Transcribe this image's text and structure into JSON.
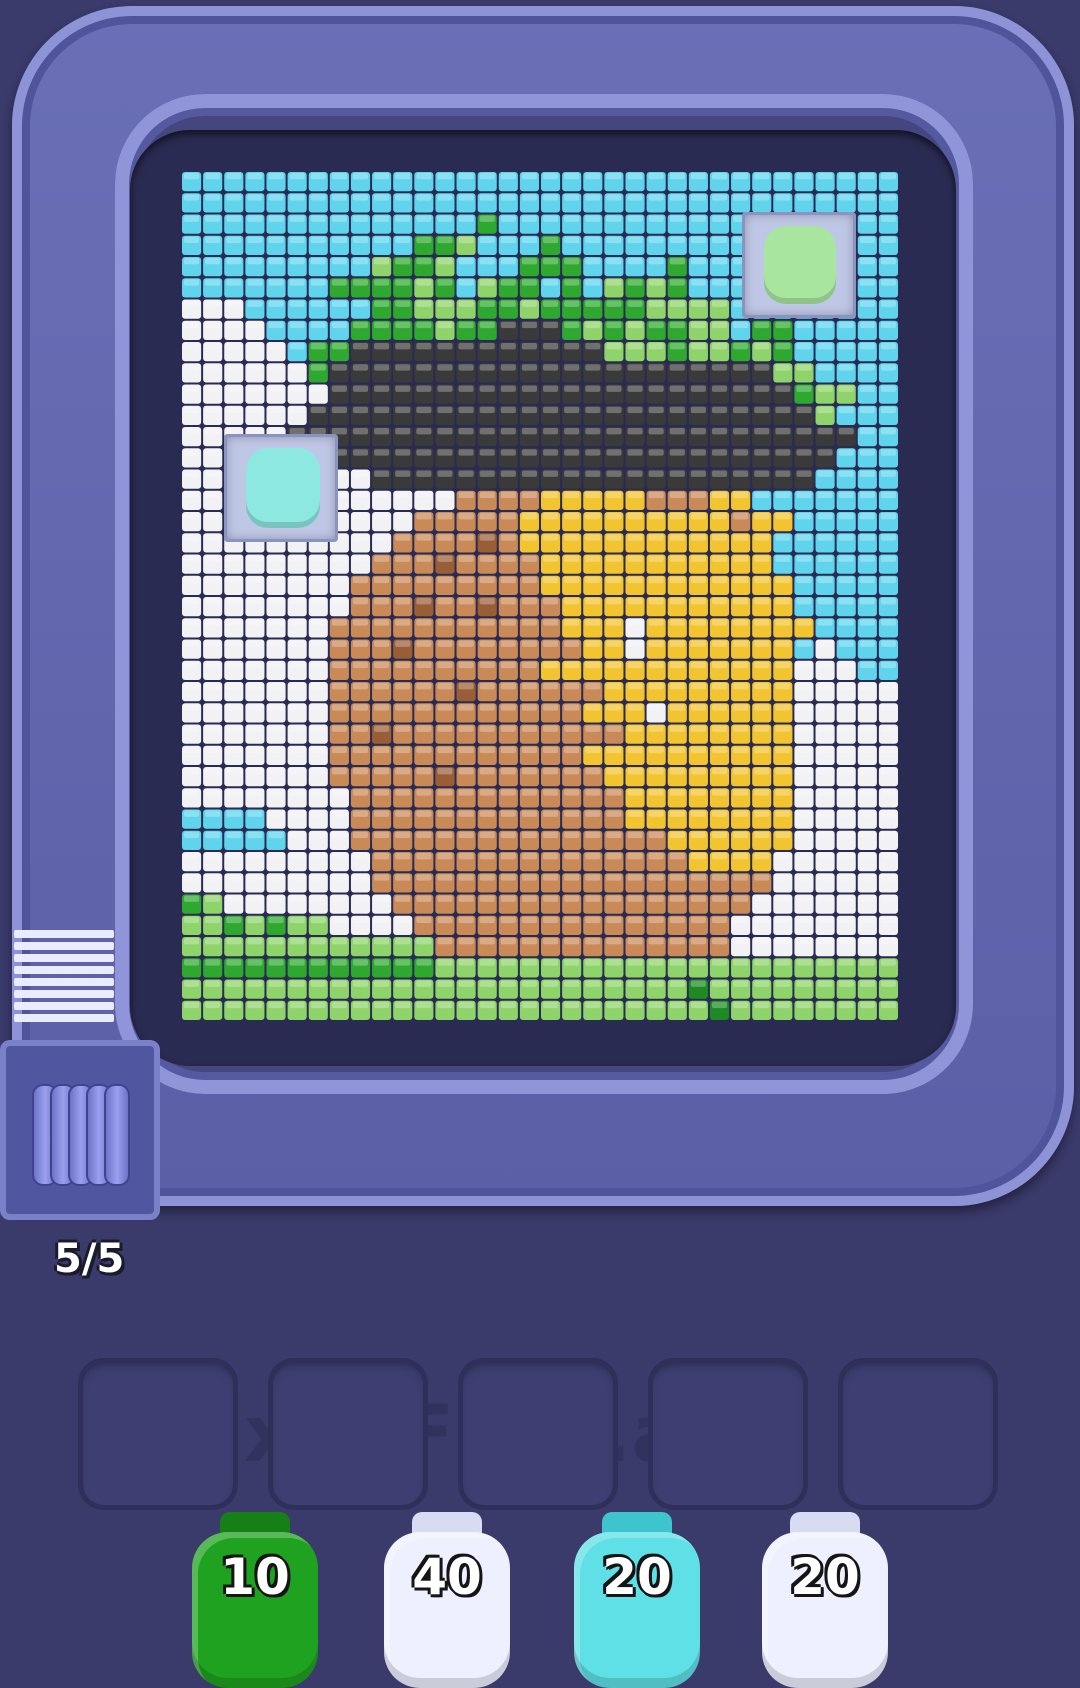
{
  "app": {
    "watermark": "Pixel Flow.app"
  },
  "hud": {
    "pig_counter": "5/5"
  },
  "board": {
    "cols": 34,
    "rows": 40,
    "palette": {
      "s": "#5fd4ec",
      "w": "#f2f2f4",
      "k": "#3a3a3a",
      "g": "#2ea82e",
      "l": "#8fd46a",
      "d": "#1d8a24",
      "b": "#c98a58",
      "n": "#9a5e36",
      "y": "#f2c430",
      "o": "#e7a630"
    },
    "grid_rows": [
      "ssssssssssssssssssssssssssssssssss",
      "ssssssssssssssssssssssssssssssssss",
      "ssssssssssssssgsssssssssssssssssss",
      "sssssssssssgglsssgssssssssssssssss",
      "ssssssssslgglsssgggssssgsssssgssss",
      "sssssssgggglgslggsgslglgssssggssss",
      "wwwssssssgglllgglgggggllllssssssss",
      "wwwwssssgggglggkkkglglggllsggsssss",
      "wwwwwsggkkkkkkkkkkkklllgllglgsssss",
      "wwwwwwgkkkkkkkkkkkkkkkkkkkkkllssss",
      "wwwwwwwkkkkkkkkkkkkkkkkkkkkkkgllss",
      "wwwwwwkkkkkkkkkkkkkkkkkkkkkkkklsss",
      "wwwwwkkkkkkkkkkkkkkkkkkkkkkkkkkkss",
      "wwwwwwwkkkkkkkkkkkkkkkkkkkkkkkksss",
      "wwwwwwwwwkkkkkkkkkkkkkkkkkkkkkssss",
      "wwwwwwwwwwwwwbbbbyyyyybbbyysssssss",
      "wwwwwwwwwwwbbbbbyyyyyyyyyybyyssssss",
      "wwwwwwwwwwbbbbnbyyyyyyyyyyyysssssss",
      "wwwwwwwwwbbbnbbbbyyyyyyyyyyyssssss",
      "wwwwwwwwbbbbbbbbbyyyyyyyyyyyysssss",
      "wwwwwwwwbbbnbbnbbbyyyyyyyyyyysssss",
      "wwwwwwwbbbbbbbbbbbyyywyyyyyyyyssss",
      "wwwwwwwbbbnbbbbbbbbyywyyyyyyyswsss",
      "wwwwwwwbbbbbbbbbbyyyyyyyyyyyywwwss",
      "wwwwwwwbbbbbbnbbbbbbyyyyyyyyywwwww",
      "wwwwwwwbbbbbbbbbbbbyyywyyyyyywwwww",
      "wwwwwwwbbnbbbbbbbbbbbyyyyyyyywwwww",
      "wwwwwwwbbbbbbbbbbbbyyyyyyyyyywwwww",
      "wwwwwwwbbbbbnbbbbbbbyyyyyyyyywwwww",
      "wwwwwwwwbbbbbbbbbbbbbyyyyyyyywwwww",
      "sssswwwwbbbbbbbbbbbbbyyyyyyyywwwww",
      "ssssswwwbbbbbbbbbbbbbbbyyyyyywwwww",
      "wwwwwwwwwbbbbbbbbbbbbbbbyyyywwwwww",
      "wwwwwwwwwbbbbbbbbbbbbbbbbbbbwwwwww",
      "glwwwwwwwwbbbbbbbbbbbbbbbbbwwwwwww",
      "llglgllwwwwbbbbbbbbbbbbbbbwwwwwwww",
      "llllllllllllbbbbbbbbbbbbbbwwwwwwww",
      "gggggggggggglllllllllllllllllllll",
      "lllllllllllllllllllllllldlllllllll",
      "llllllllllllllllllllllllldllllllll"
    ]
  },
  "board_pigs": [
    {
      "name": "board-pig-green",
      "color": "#a8e6a0"
    },
    {
      "name": "board-pig-cyan",
      "color": "#8ee8e2"
    }
  ],
  "slots": [
    "",
    "",
    "",
    "",
    ""
  ],
  "pigs": [
    {
      "color": "green",
      "hex": "#1fa21f",
      "ear": "#168016",
      "count": "10"
    },
    {
      "color": "white",
      "hex": "#eef0ff",
      "ear": "#d8dcf2",
      "count": "40"
    },
    {
      "color": "cyan",
      "hex": "#5fe0e6",
      "ear": "#3ec4cc",
      "count": "20"
    },
    {
      "color": "white",
      "hex": "#eef0ff",
      "ear": "#d8dcf2",
      "count": "20"
    }
  ]
}
